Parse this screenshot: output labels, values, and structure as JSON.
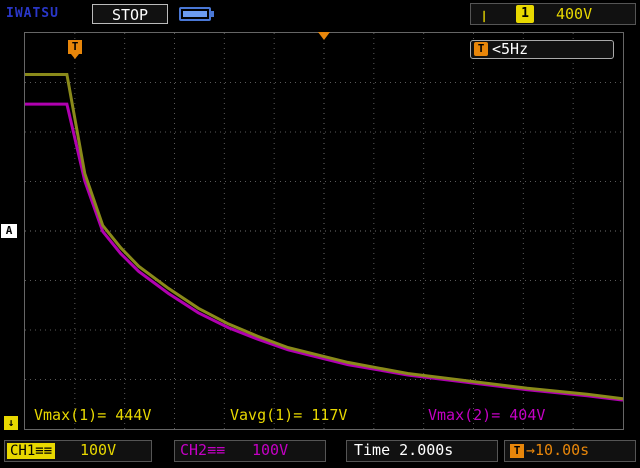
{
  "header": {
    "brand": "IWATSU",
    "run_state": "STOP",
    "trigger_edge_symbol": "ꞁ",
    "trigger_source": "1",
    "trigger_level": "400V"
  },
  "screen": {
    "trigger_freq": "<5Hz",
    "trigger_pos_icon": "T",
    "level_marker": "A",
    "ground_marker": "↓"
  },
  "measurements": {
    "m1": "Vmax(1)= 444V",
    "m2": "Vavg(1)= 117V",
    "m3": "Vmax(2)= 404V"
  },
  "footer": {
    "ch1_label": "CH1≡≡",
    "ch1_scale": "100V",
    "ch2_label": "CH2≡≡",
    "ch2_scale": "100V",
    "timebase": "Time 2.000s",
    "delay_icon": "T",
    "delay": "→10.00s"
  },
  "colors": {
    "ch1": "#8a8a1a",
    "ch2": "#b000b0",
    "grid": "#5a5a5a",
    "trigger": "#e8860a"
  },
  "chart_data": {
    "type": "line",
    "x_unit": "s",
    "y_unit": "V",
    "xlim": [
      -0.8,
      19.2
    ],
    "ylim": [
      -35,
      500
    ],
    "series": [
      {
        "name": "CH1",
        "x": [
          -0.8,
          0.6,
          1.2,
          1.8,
          2.4,
          3.0,
          4.0,
          5.0,
          6.0,
          7.0,
          8.0,
          10.0,
          12.0,
          14.0,
          16.0,
          18.0,
          19.2
        ],
        "y": [
          444,
          444,
          310,
          240,
          210,
          185,
          155,
          128,
          107,
          90,
          75,
          55,
          40,
          30,
          20,
          12,
          6
        ]
      },
      {
        "name": "CH2",
        "x": [
          -0.8,
          0.6,
          1.2,
          1.8,
          2.4,
          3.0,
          4.0,
          5.0,
          6.0,
          7.0,
          8.0,
          10.0,
          12.0,
          14.0,
          16.0,
          18.0,
          19.2
        ],
        "y": [
          404,
          404,
          300,
          232,
          202,
          178,
          148,
          122,
          102,
          86,
          72,
          52,
          38,
          28,
          18,
          10,
          4
        ]
      }
    ]
  }
}
